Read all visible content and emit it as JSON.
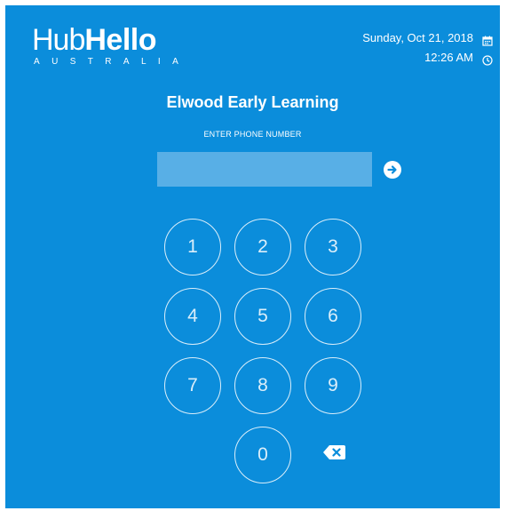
{
  "brand": {
    "name_part1": "Hub",
    "name_part2": "Hello",
    "region": "AUSTRALIA"
  },
  "header": {
    "date": "Sunday, Oct 21, 2018",
    "time": "12:26 AM",
    "calendar_icon": "calendar-icon",
    "clock_icon": "clock-icon"
  },
  "main": {
    "title": "Elwood Early Learning",
    "prompt": "ENTER PHONE NUMBER",
    "phone_value": "",
    "phone_placeholder": "",
    "submit_icon": "arrow-right-circle-icon"
  },
  "keypad": {
    "keys": [
      "1",
      "2",
      "3",
      "4",
      "5",
      "6",
      "7",
      "8",
      "9",
      "0"
    ],
    "backspace_icon": "backspace-icon"
  },
  "colors": {
    "background": "#0b8ddb",
    "input_background": "#58afe6",
    "text": "#ffffff"
  }
}
